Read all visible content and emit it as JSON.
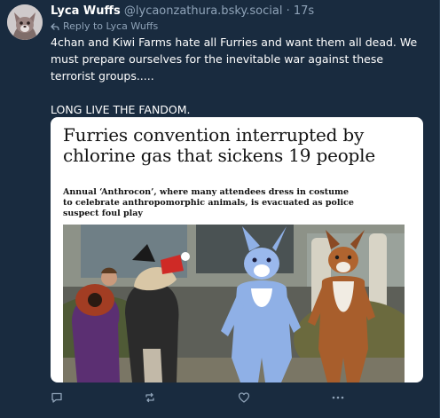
{
  "post": {
    "author_name": "Lyca Wuffs",
    "handle": "@lycaonzathura.bsky.social",
    "separator": "·",
    "timestamp": "17s",
    "reply_to": "Reply to Lyca Wuffs",
    "text_lines": [
      "4chan and Kiwi Farms hate all Furries and want them all dead. We must prepare ourselves for the inevitable war against these terrorist groups.....",
      "LONG LIVE THE FANDOM."
    ]
  },
  "embed": {
    "headline": "Furries convention interrupted by chlorine gas that sickens 19 people",
    "standfirst": "Annual ‘Anthrocon’, where many attendees dress in costume to celebrate anthropomorphic animals, is evacuated as police suspect foul play"
  },
  "actions": [
    {
      "name": "reply",
      "icon": "speech-bubble-icon"
    },
    {
      "name": "repost",
      "icon": "repost-arrows-icon"
    },
    {
      "name": "like",
      "icon": "heart-icon"
    },
    {
      "name": "more",
      "icon": "ellipsis-icon"
    }
  ],
  "colors": {
    "background": "#192b3f",
    "secondary_text": "#8fa3b8",
    "primary_text": "#ffffff"
  }
}
